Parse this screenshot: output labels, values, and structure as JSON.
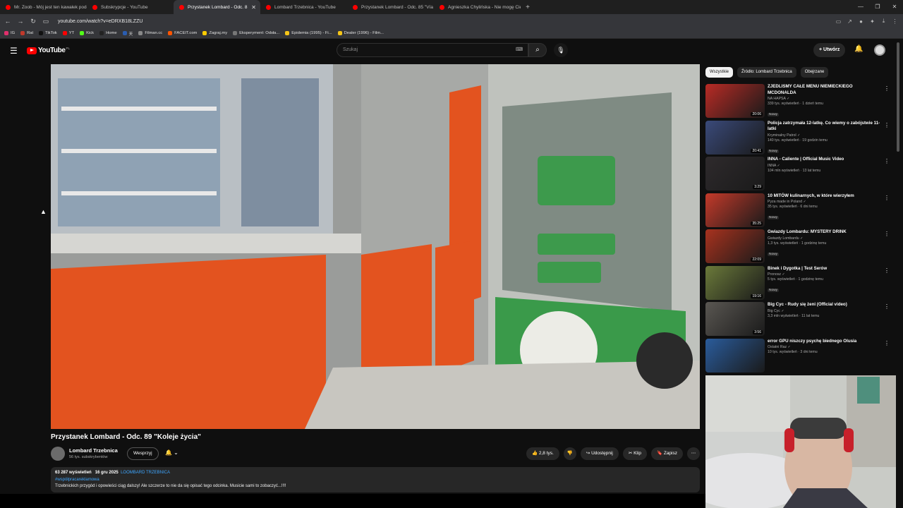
{
  "browser": {
    "tabs": [
      {
        "title": "Mr. Zoob - Mój jest ten kawałek podł",
        "color": "#ff0000"
      },
      {
        "title": "Subskrypcje - YouTube",
        "color": "#ff0000"
      },
      {
        "title": "Przystanek Lombard - Odc. 8",
        "color": "#ff0000",
        "active": true
      },
      {
        "title": "Lombard Trzebnica - YouTube",
        "color": "#ff0000"
      },
      {
        "title": "Przystanek Lombard - Odc. 85 \"Vía V",
        "color": "#ff0000"
      },
      {
        "title": "Agnieszka Chylińska - Nie mogę Cię",
        "color": "#ff0000"
      }
    ],
    "url": "youtube.com/watch?v=eDRXB18LZZU",
    "bookmarks": [
      "IG",
      "Rat",
      "TikTok",
      "YT",
      "Kick",
      "Home",
      "天",
      "Filman.cc",
      "FACEIT.com",
      "Zagraj.my",
      "Eksperyment: Odsła...",
      "Epidemia (1995) - Fi...",
      "Dealer (1996) - Film..."
    ]
  },
  "header": {
    "logo": "YouTube",
    "country": "PL",
    "search_placeholder": "Szukaj",
    "create_label": "+ Utwórz"
  },
  "video": {
    "title": "Przystanek Lombard - Odc. 89 \"Koleje życia\"",
    "channel": "Lombard Trzebnica",
    "subscribers": "56 tys. subskrybentów",
    "support_label": "Wesprzyj",
    "likes": "2,8 tys.",
    "share_label": "Udostępnij",
    "clip_label": "Klip",
    "save_label": "Zapisz",
    "views": "63 287 wyświetleń",
    "date": "16 gru 2025",
    "channel_link": "LOOMBARD TRZEBNICA",
    "hashtag": "#współpracareklamowa",
    "description": "Trzebnickich przygód i opowieści ciąg dalszy! Ale szczerze to nie da się opisać tego odcinka. Musicie sami to zobaczyć...!!!!"
  },
  "chips": [
    "Wszystkie",
    "Źródło: Lombard Trzebnica",
    "Obejrzane"
  ],
  "recommendations": [
    {
      "title": "ZJEDLIŚMY CAŁE MENU NIEMIECKIEGO MCDONALDA",
      "channel": "NA HAPSA",
      "meta": "339 tys. wyświetleń · 1 dzień temu",
      "badge": "Nowy",
      "duration": "20:06",
      "color": "#b92b25"
    },
    {
      "title": "Policja zatrzymała 12-latkę. Co wiemy o zabójstwie 11-latki",
      "channel": "Kryminalny Patrol",
      "meta": "140 tys. wyświetleń · 19 godzin temu",
      "badge": "Nowy",
      "duration": "20:41",
      "color": "#3a4a7a"
    },
    {
      "title": "INNA - Caliente | Official Music Video",
      "channel": "INNA",
      "meta": "104 mln wyświetleń · 13 lat temu",
      "badge": "",
      "duration": "3:29",
      "color": "#2e2a2c"
    },
    {
      "title": "10 MITÓW kulinarnych, w które wierzyłem",
      "channel": "Pyza made in Poland",
      "meta": "35 tys. wyświetleń · 6 dni temu",
      "badge": "Nowy",
      "duration": "35:25",
      "color": "#c43a2a"
    },
    {
      "title": "Gwiazdy Lombardu: MYSTERY DRINK",
      "channel": "Gwiazdy Lombardu",
      "meta": "1,3 tys. wyświetleń · 1 godzinę temu",
      "badge": "Nowy",
      "duration": "22:09",
      "color": "#a8321e"
    },
    {
      "title": "Binek i Dygotka | Test Serów",
      "channel": "Pronosz",
      "meta": "5 tys. wyświetleń · 1 godzinę temu",
      "badge": "Nowy",
      "duration": "19:16",
      "color": "#6b7a3a"
    },
    {
      "title": "Big Cyc - Rudy się żeni (Official video)",
      "channel": "Big Cyc",
      "meta": "3,3 mln wyświetleń · 11 lat temu",
      "badge": "",
      "duration": "3:56",
      "color": "#5a5752"
    },
    {
      "title": "error GPU niszczy psychę biednego Olusia",
      "channel": "Ostatni Raz",
      "meta": "10 tys. wyświetleń · 3 dni temu",
      "badge": "",
      "duration": "",
      "color": "#2a5c9c"
    }
  ]
}
